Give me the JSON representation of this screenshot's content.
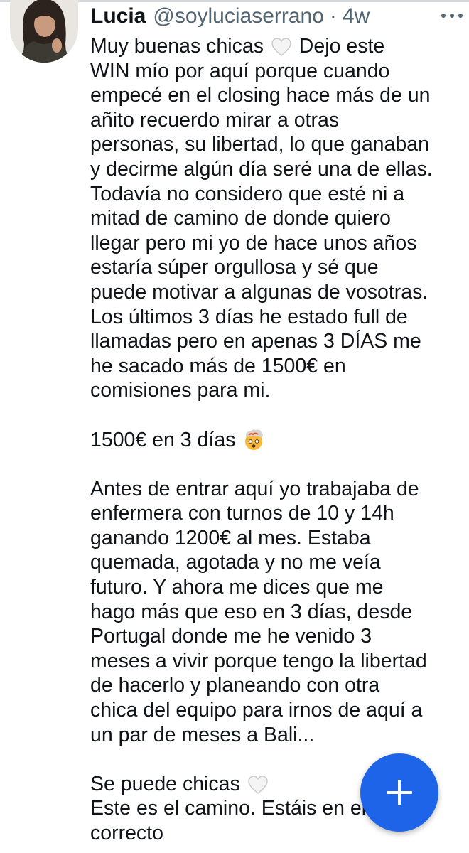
{
  "tweet": {
    "author": {
      "display_name": "Lucia",
      "handle": "@soyluciaserrano",
      "separator": "·",
      "time": "4w"
    },
    "more_icon": "more-horizontal-icon",
    "lines": [
      {
        "before": "Muy buenas chicas ",
        "emoji": "white-heart",
        "after": " Dejo este"
      },
      {
        "text": "WIN mío por aquí porque cuando"
      },
      {
        "text": "empecé en el closing hace más de un"
      },
      {
        "text": "añito recuerdo mirar a otras"
      },
      {
        "text": "personas, su libertad, lo que ganaban"
      },
      {
        "text": "y decirme algún día seré una de ellas."
      },
      {
        "text": "Todavía no considero que esté ni a"
      },
      {
        "text": "mitad de camino de donde quiero"
      },
      {
        "text": "llegar pero mi yo de hace unos años"
      },
      {
        "text": "estaría súper orgullosa y sé que"
      },
      {
        "text": "puede motivar a algunas de vosotras."
      },
      {
        "text": "Los últimos 3 días he estado full de"
      },
      {
        "text": "llamadas pero en apenas 3 DÍAS me"
      },
      {
        "text": "he sacado más de 1500€ en"
      },
      {
        "text": "comisiones para mi."
      },
      {
        "blank": true
      },
      {
        "before": "1500€ en 3 días ",
        "emoji": "exploding-head",
        "after": ""
      },
      {
        "blank": true
      },
      {
        "text": "Antes de entrar aquí yo trabajaba de"
      },
      {
        "text": "enfermera con turnos de 10 y 14h"
      },
      {
        "text": "ganando 1200€ al mes. Estaba"
      },
      {
        "text": "quemada, agotada y no me veía"
      },
      {
        "text": "futuro. Y ahora me dices que me"
      },
      {
        "text": "hago más que eso en 3 días, desde"
      },
      {
        "text": "Portugal donde me he venido 3"
      },
      {
        "text": "meses a vivir porque tengo la libertad"
      },
      {
        "text": "de hacerlo y planeando con otra"
      },
      {
        "text": "chica del equipo para irnos de aquí a"
      },
      {
        "text": "un par de meses a Bali..."
      },
      {
        "blank": true
      },
      {
        "before": "Se puede chicas ",
        "emoji": "white-heart",
        "after": ""
      },
      {
        "text": "Este es el camino. Estáis en el"
      },
      {
        "text": "correcto"
      }
    ]
  },
  "compose_button": {
    "icon": "plus-icon",
    "color": "#1d64e8"
  }
}
